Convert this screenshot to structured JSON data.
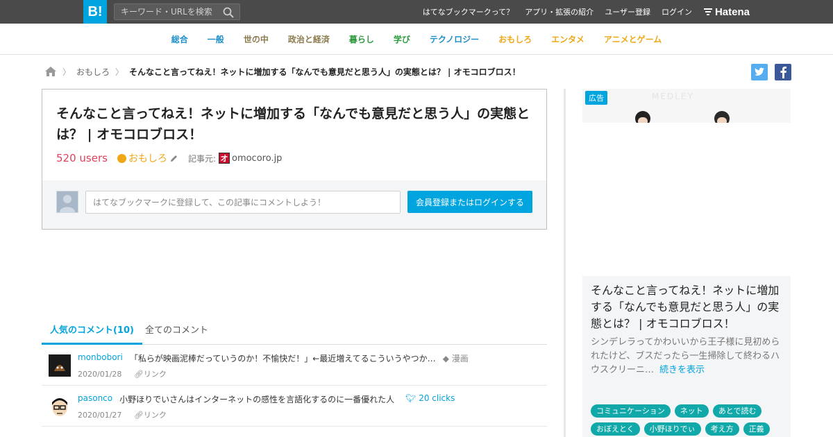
{
  "topbar": {
    "logo": "B!",
    "search_placeholder": "キーワード・URLを検索",
    "nav": [
      "はてなブックマークって？",
      "アプリ・拡張の紹介",
      "ユーザー登録",
      "ログイン"
    ],
    "brand": "Hatena"
  },
  "categories": [
    {
      "label": "総合",
      "color": "#1f8fc9"
    },
    {
      "label": "一般",
      "color": "#1f8fc9"
    },
    {
      "label": "世の中",
      "color": "#8b7a4e"
    },
    {
      "label": "政治と経済",
      "color": "#8b7a4e"
    },
    {
      "label": "暮らし",
      "color": "#2e9a3e"
    },
    {
      "label": "学び",
      "color": "#2e9a3e"
    },
    {
      "label": "テクノロジー",
      "color": "#1f8fc9"
    },
    {
      "label": "おもしろ",
      "color": "#f0a716"
    },
    {
      "label": "エンタメ",
      "color": "#f0a716"
    },
    {
      "label": "アニメとゲーム",
      "color": "#f0a716"
    }
  ],
  "breadcrumb": {
    "category": "おもしろ",
    "current": "そんなこと言ってねえ！ネットに増加する「なんでも意見だと思う人」の実態とは？ | オモコロブロス！"
  },
  "entry": {
    "title": "そんなこと言ってねえ！ネットに増加する「なんでも意見だと思う人」の実態とは？ | オモコロブロス！",
    "users": "520 users",
    "category": "おもしろ",
    "source_label": "記事元:",
    "source_fav": "オ",
    "source": "omocoro.jp",
    "comment_placeholder": "はてなブックマークに登録して、この記事にコメントしよう！",
    "login_button": "会員登録またはログインする"
  },
  "tabs": {
    "popular": "人気のコメント(10)",
    "all": "全てのコメント"
  },
  "comments": [
    {
      "user": "monbobori",
      "text": "「私らが映画泥棒だっていうのか！不愉快だ！」←最近増えてるこういうやつか…",
      "tag": "漫画",
      "clicks": "",
      "date": "2020/01/28",
      "link": "リンク"
    },
    {
      "user": "pasonco",
      "text": "小野ほりでいさんはインターネットの感性を言語化するのに一番優れた人",
      "tag": "",
      "clicks": "20 clicks",
      "date": "2020/01/27",
      "link": "リンク"
    }
  ],
  "sidebar": {
    "ad_badge": "広告",
    "ad_watermark": "MEDLEY",
    "title": "そんなこと言ってねえ！ネットに増加する「なんでも意見だと思う人」の実態とは？ | オモコロブロス！",
    "description": "シンデレラってかわいいから王子様に見初められたけど、ブスだったら一生掃除して終わるハウスクリーニ…",
    "more": "続きを表示",
    "tags": [
      "コミュニケーション",
      "ネット",
      "あとで読む",
      "おぼえとく",
      "小野ほりでぃ",
      "考え方",
      "正義"
    ]
  }
}
